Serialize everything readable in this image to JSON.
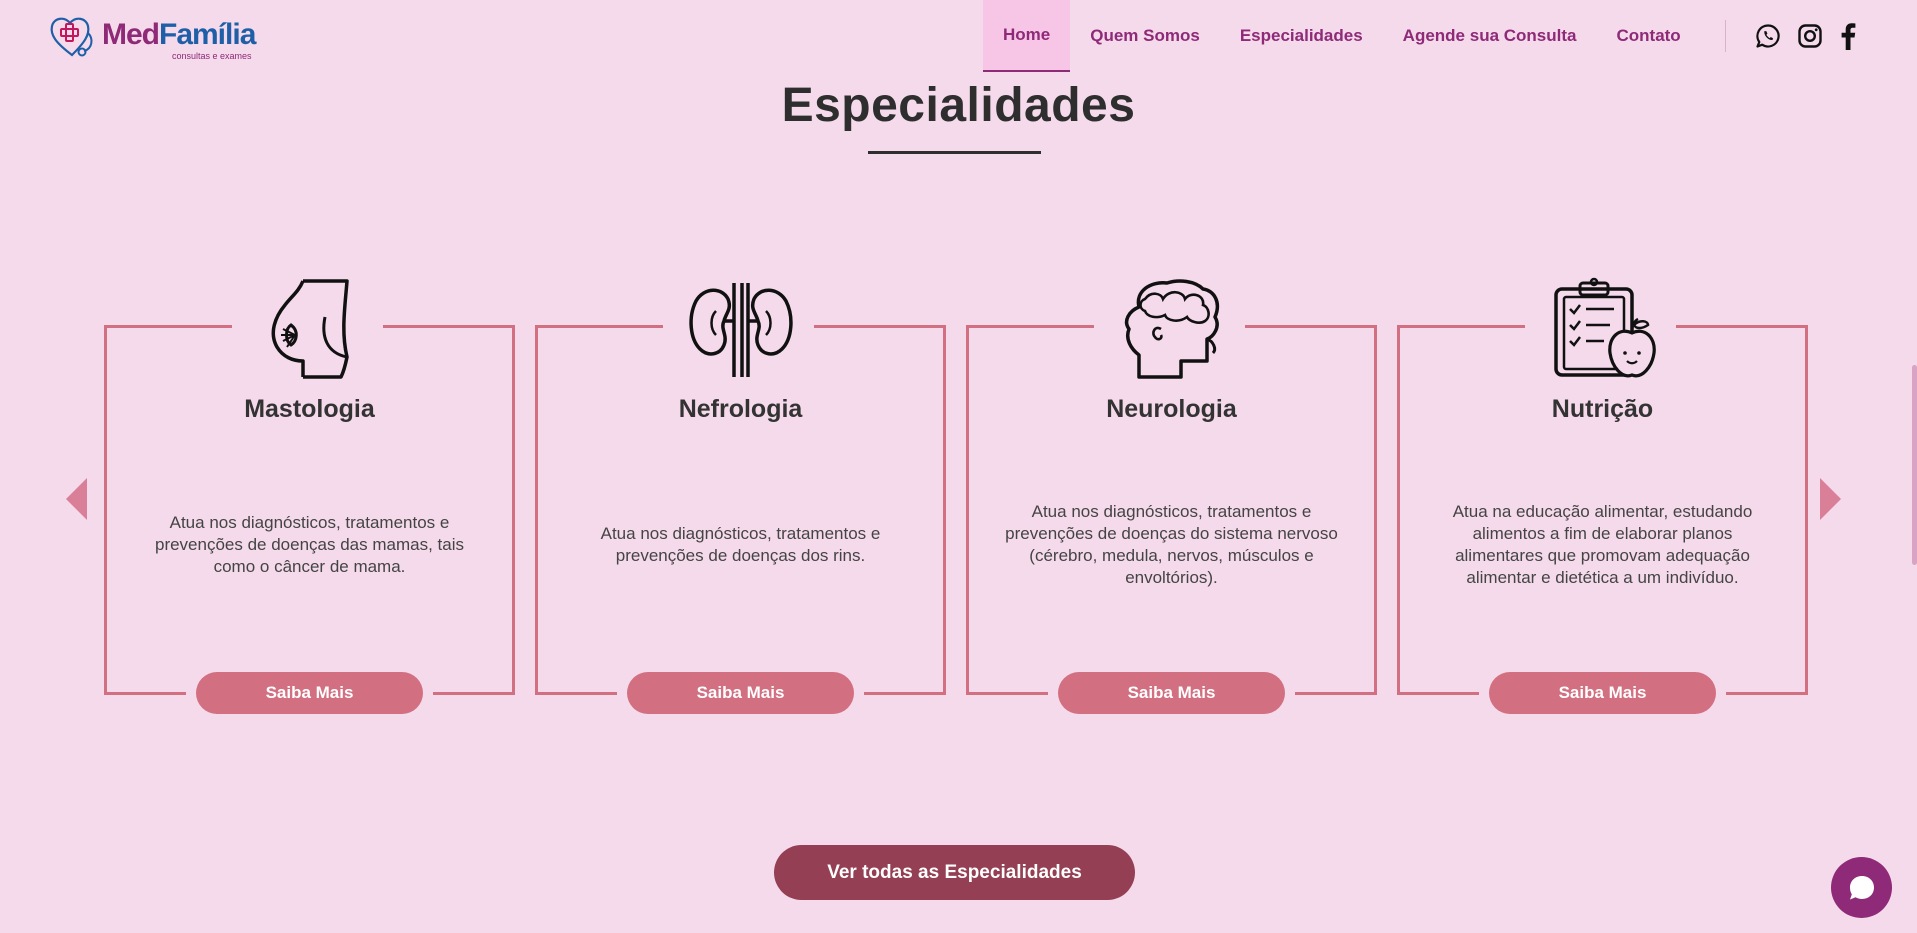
{
  "header": {
    "logo": {
      "word1": "Med",
      "word2": "Família",
      "tagline": "consultas e exames"
    },
    "nav": [
      {
        "label": "Home",
        "active": true
      },
      {
        "label": "Quem Somos"
      },
      {
        "label": "Especialidades"
      },
      {
        "label": "Agende sua Consulta"
      },
      {
        "label": "Contato"
      }
    ],
    "social": [
      "whatsapp-icon",
      "instagram-icon",
      "facebook-icon"
    ]
  },
  "section": {
    "title": "Especialidades"
  },
  "cards": [
    {
      "title": "Mastologia",
      "icon": "breast-icon",
      "description": "Atua nos diagnósticos, tratamentos e prevenções de doenças das mamas, tais como o câncer de mama.",
      "button": "Saiba Mais"
    },
    {
      "title": "Nefrologia",
      "icon": "kidneys-icon",
      "description": "Atua nos diagnósticos, tratamentos e prevenções de doenças dos rins.",
      "button": "Saiba Mais"
    },
    {
      "title": "Neurologia",
      "icon": "brain-head-icon",
      "description": "Atua nos diagnósticos, tratamentos e prevenções de doenças do sistema nervoso (cérebro, medula, nervos, músculos e envoltórios).",
      "button": "Saiba Mais"
    },
    {
      "title": "Nutrição",
      "icon": "clipboard-apple-icon",
      "description": "Atua na educação alimentar, estudando alimentos a fim de elaborar planos alimentares que promovam adequação alimentar e dietética a um indivíduo.",
      "button": "Saiba Mais"
    }
  ],
  "cta": {
    "label": "Ver todas as Especialidades"
  },
  "colors": {
    "background": "#f5daeb",
    "brand_purple": "#8e2a78",
    "brand_blue": "#1f5fa8",
    "card_border": "#d26f80",
    "button": "#d26f80",
    "cta": "#943f53",
    "arrow": "#d97f97"
  }
}
